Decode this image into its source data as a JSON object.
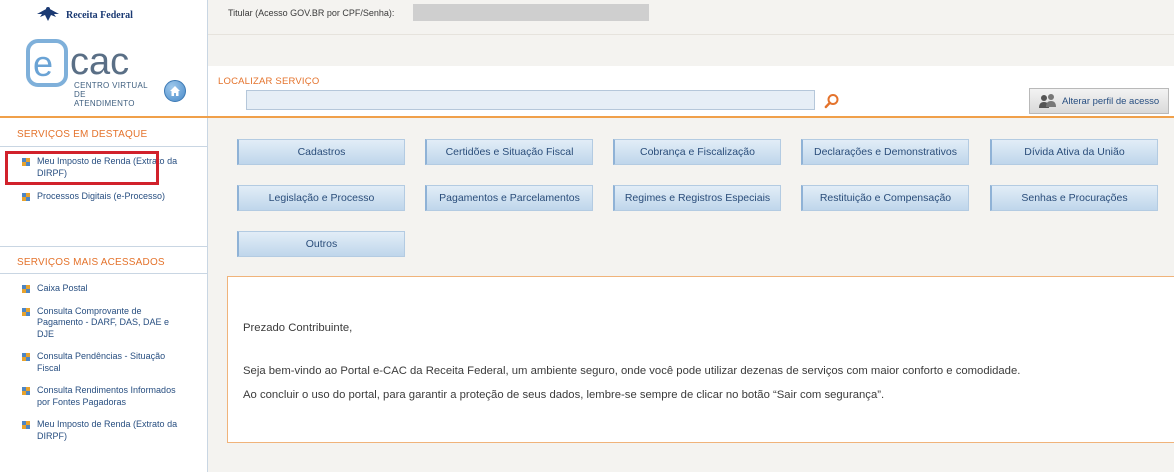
{
  "header": {
    "brand": "Receita Federal",
    "app_logo": "ecac",
    "app_logo_subtitle_1": "CENTRO VIRTUAL",
    "app_logo_subtitle_2": "DE ATENDIMENTO",
    "titular_label": "Titular (Acesso GOV.BR por CPF/Senha):",
    "home_icon": "home-icon"
  },
  "search": {
    "label": "LOCALIZAR SERVIÇO",
    "value": "",
    "placeholder": "",
    "search_icon": "magnifier-icon",
    "profile_button_label": "Alterar perfil de acesso",
    "profile_icon": "users-icon"
  },
  "sidebar": {
    "featured_title": "SERVIÇOS EM DESTAQUE",
    "featured_items": [
      {
        "label": "Meu Imposto de Renda (Extrato da DIRPF)"
      },
      {
        "label": "Processos Digitais (e-Processo)"
      }
    ],
    "most_accessed_title": "SERVIÇOS MAIS ACESSADOS",
    "most_accessed_items": [
      {
        "label": "Caixa Postal"
      },
      {
        "label": "Consulta Comprovante de Pagamento - DARF, DAS, DAE e DJE"
      },
      {
        "label": "Consulta Pendências - Situação Fiscal"
      },
      {
        "label": "Consulta Rendimentos Informados por Fontes Pagadoras"
      },
      {
        "label": "Meu Imposto de Renda (Extrato da DIRPF)"
      }
    ],
    "highlight_color": "#d1212b"
  },
  "services": [
    "Cadastros",
    "Certidões e Situação Fiscal",
    "Cobrança e Fiscalização",
    "Declarações e Demonstrativos",
    "Dívida Ativa da União",
    "Legislação e Processo",
    "Pagamentos e Parcelamentos",
    "Regimes e Registros Especiais",
    "Restituição e Compensação",
    "Senhas e Procurações",
    "Outros"
  ],
  "welcome": {
    "greeting": "Prezado Contribuinte,",
    "line1": "Seja bem-vindo ao Portal e-CAC da Receita Federal, um ambiente seguro, onde você pode utilizar dezenas de serviços com maior conforto e comodidade.",
    "line2": "Ao concluir o uso do portal, para garantir a proteção de seus dados, lembre-se sempre de clicar no botão “Sair com segurança”."
  },
  "colors": {
    "accent_orange": "#e4732c",
    "link_blue": "#274e80",
    "button_blue": "#bfd6eb"
  }
}
